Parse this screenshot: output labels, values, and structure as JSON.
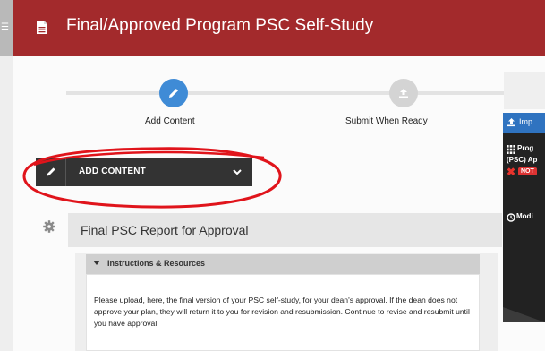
{
  "header": {
    "title": "Final/Approved Program PSC Self-Study"
  },
  "steps": [
    {
      "label": "Add Content",
      "state": "active"
    },
    {
      "label": "Submit When Ready",
      "state": "inactive"
    }
  ],
  "side_panel": {
    "head_text": "Imp",
    "line1": "Prog",
    "line2": "(PSC) Ap",
    "status_badge": "NOT",
    "modified_text": "Modi"
  },
  "add_content": {
    "label": "ADD CONTENT"
  },
  "section": {
    "title": "Final PSC Report for Approval",
    "instructions_label": "Instructions & Resources",
    "instructions_text": "Please upload, here, the final version of your PSC self-study, for your dean's approval. If the dean does not approve your plan, they will return it to you for revision and resubmission. Continue to revise and resubmit until you have approval."
  },
  "colors": {
    "header_bg": "#a32a2c",
    "step_active": "#3f8bd6",
    "step_inactive": "#d4d4d4",
    "add_content_bg": "#333333",
    "side_panel_head": "#2f73c0",
    "annotation": "#e0141b"
  },
  "icons": {
    "header": "document-icon",
    "step1": "pencil-icon",
    "step2": "upload-icon",
    "add_content": "pencil-icon",
    "dropdown": "chevron-down-icon",
    "section": "gear-icon",
    "instructions": "caret-down-icon"
  }
}
